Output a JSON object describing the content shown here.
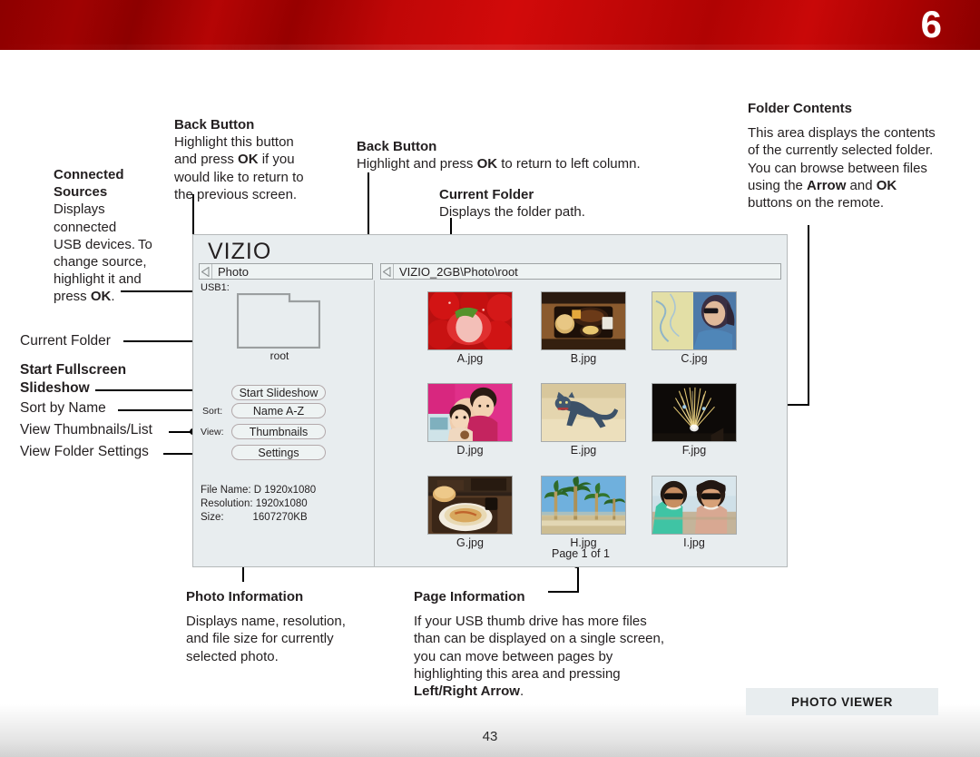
{
  "header": {
    "chapter_number": "6"
  },
  "footer": {
    "page_number": "43",
    "section_tab": "PHOTO VIEWER"
  },
  "annotations": {
    "connected_sources": {
      "title_line1": "Connected",
      "title_line2": "Sources",
      "body": "Displays connected USB devices. To change source, highlight it and press OK."
    },
    "back_button_left": {
      "title": "Back Button",
      "body": "Highlight this button and press OK if you would like to return to the previous screen."
    },
    "back_button_mid": {
      "title": "Back Button",
      "body": "Highlight and press OK to return to left column."
    },
    "current_folder_path": {
      "title": "Current Folder",
      "body": "Displays the folder path."
    },
    "folder_contents": {
      "title": "Folder Contents",
      "body": "This area displays the contents of the currently selected folder. You can browse between files using the Arrow and OK buttons on the remote."
    },
    "current_folder": {
      "title": "Current Folder"
    },
    "start_slideshow": {
      "title_line1": "Start Fullscreen",
      "title_line2": "Slideshow"
    },
    "sort_by_name": {
      "title": "Sort by Name"
    },
    "view_thumbnails": {
      "title": "View Thumbnails/List"
    },
    "view_folder_settings": {
      "title": "View Folder Settings"
    },
    "photo_information": {
      "title": "Photo Information",
      "body": "Displays name, resolution, and file size for currently selected photo."
    },
    "page_information": {
      "title": "Page Information",
      "body": "If your USB thumb drive has more files than can be displayed on a single screen, you can move between pages by highlighting this area and pressing Left/Right Arrow."
    }
  },
  "tv_screen": {
    "brand": "VIZIO",
    "nav_left_label": "Photo",
    "nav_right_label": "VIZIO_2GB\\Photo\\root",
    "usb_label": "USB1:",
    "folder_name": "root",
    "buttons": {
      "start_slideshow": "Start Slideshow",
      "sort_prefix": "Sort:",
      "sort_value": "Name A-Z",
      "view_prefix": "View:",
      "view_value": "Thumbnails",
      "settings": "Settings"
    },
    "file_info": {
      "file_name_label": "File Name:",
      "file_name_value": "D 1920x1080",
      "resolution_label": "Resolution:",
      "resolution_value": "1920x1080",
      "size_label": "Size:",
      "size_value": "1607270KB",
      "block": "File Name: D 1920x1080\nResolution: 1920x1080\nSize:          1607270KB"
    },
    "page_info": "Page 1 of 1",
    "thumbnails": [
      {
        "label": "A.jpg",
        "subject": "strawberries",
        "c1": "#d61616",
        "c2": "#8d0b0b",
        "c3": "#f2b4ad",
        "c4": "#4a8c2a"
      },
      {
        "label": "B.jpg",
        "subject": "food-tray",
        "c1": "#3a2418",
        "c2": "#c9972f",
        "c3": "#e8d49a",
        "c4": "#7d4a22"
      },
      {
        "label": "C.jpg",
        "subject": "woman-sunglasses-map",
        "c1": "#e3dfa2",
        "c2": "#4a6f9c",
        "c3": "#3b3046",
        "c4": "#c8b98c"
      },
      {
        "label": "D.jpg",
        "subject": "two-girls-pink",
        "c1": "#e8338f",
        "c2": "#f2cfae",
        "c3": "#b8235f",
        "c4": "#ffe9d4"
      },
      {
        "label": "E.jpg",
        "subject": "cat-on-floor",
        "c1": "#e8d9b4",
        "c2": "#3a4e68",
        "c3": "#c9b48a",
        "c4": "#1e2a38"
      },
      {
        "label": "F.jpg",
        "subject": "fireworks-night",
        "c1": "#100d0a",
        "c2": "#e8c86a",
        "c3": "#f5e3a8",
        "c4": "#2a2018"
      },
      {
        "label": "G.jpg",
        "subject": "pasta-plate",
        "c1": "#2e2018",
        "c2": "#e8d9b4",
        "c3": "#c96a3a",
        "c4": "#7d5a35"
      },
      {
        "label": "H.jpg",
        "subject": "palm-trees-sky",
        "c1": "#6aa8d8",
        "c2": "#2f6b2a",
        "c3": "#cdbb8e",
        "c4": "#8fc3e6"
      },
      {
        "label": "I.jpg",
        "subject": "couple-sunglasses",
        "c1": "#cfe2ea",
        "c2": "#3fbfa0",
        "c3": "#2a2018",
        "c4": "#d9a98a"
      }
    ]
  }
}
